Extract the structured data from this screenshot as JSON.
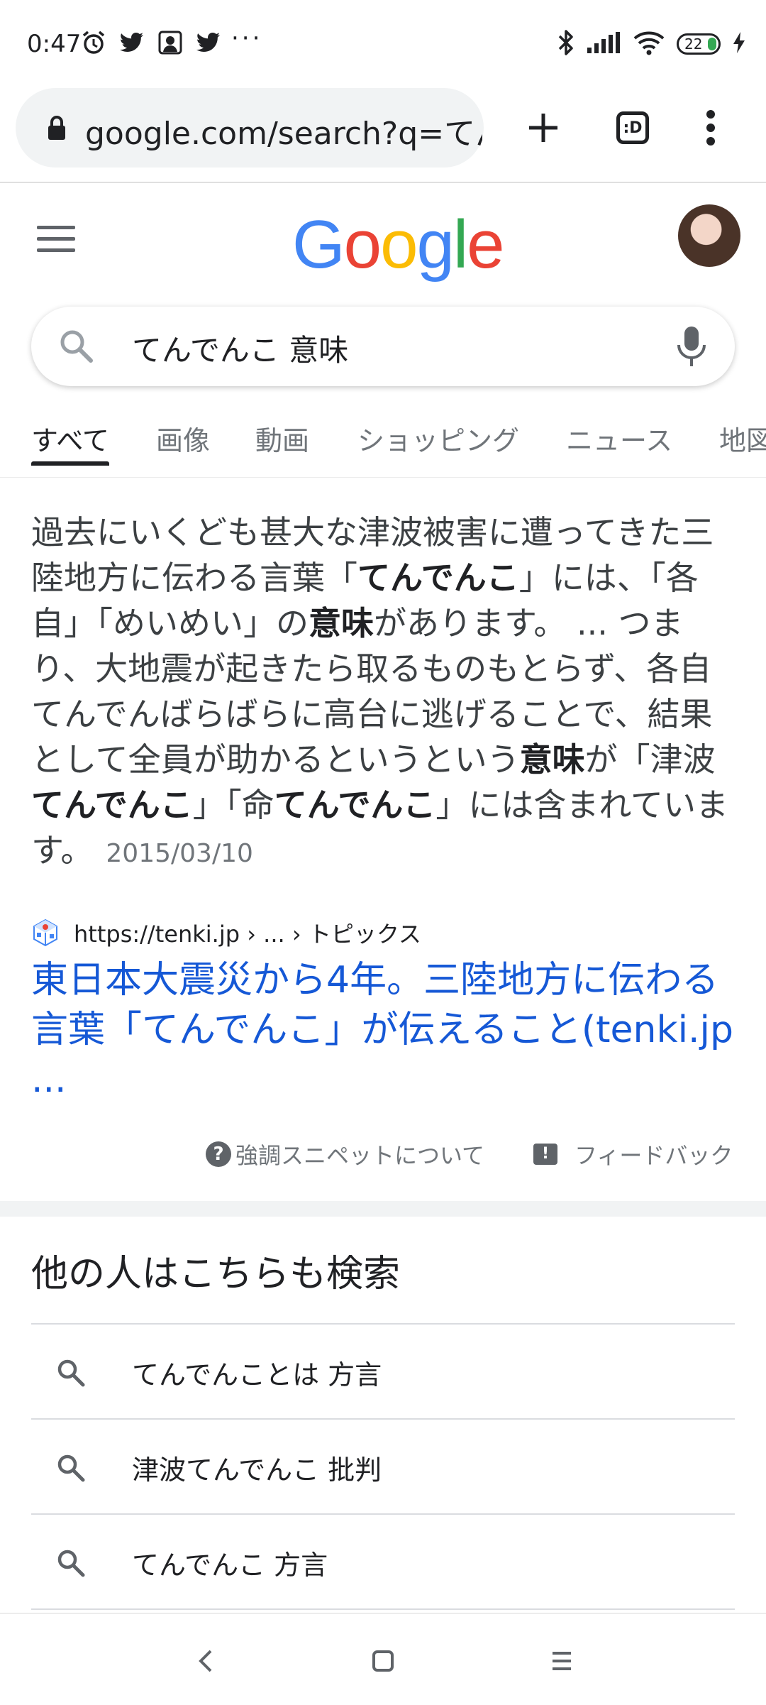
{
  "status_bar": {
    "time": "0:47",
    "overflow": "···",
    "battery_level": "22",
    "icons_left": [
      "alarm-icon",
      "twitter-icon",
      "app-icon",
      "twitter-icon"
    ],
    "icons_right": [
      "bluetooth-icon",
      "signal-icon",
      "wifi-icon",
      "battery-icon",
      "charging-icon"
    ]
  },
  "browser": {
    "url": "google.com/search?q=てんでんこ 意味",
    "tab_count": ":D"
  },
  "google": {
    "logo": [
      "G",
      "o",
      "o",
      "g",
      "l",
      "e"
    ],
    "logo_colors": [
      "#4285F4",
      "#EA4335",
      "#FBBC05",
      "#4285F4",
      "#34A853",
      "#EA4335"
    ],
    "query": "てんでんこ 意味"
  },
  "tabs": [
    "すべて",
    "画像",
    "動画",
    "ショッピング",
    "ニュース",
    "地図"
  ],
  "snippet": {
    "parts": [
      {
        "t": "過去にいくども甚大な津波被害に遭ってきた三陸地方に伝わる言葉「",
        "b": false
      },
      {
        "t": "てんでんこ",
        "b": true
      },
      {
        "t": "」には、「各自」「めいめい」の",
        "b": false
      },
      {
        "t": "意味",
        "b": true
      },
      {
        "t": "があります。 ... つまり、大地震が起きたら取るものもとらず、各自てんでんばらばらに高台に逃げることで、結果として全員が助かるというという",
        "b": false
      },
      {
        "t": "意味",
        "b": true
      },
      {
        "t": "が「津波",
        "b": false
      },
      {
        "t": "てんでんこ",
        "b": true
      },
      {
        "t": "」「命",
        "b": false
      },
      {
        "t": "てんでんこ",
        "b": true
      },
      {
        "t": "」には含まれています。",
        "b": false
      }
    ],
    "date": "2015/03/10",
    "source_url": "https://tenki.jp › ... › トピックス",
    "title": "東日本大震災から4年。三陸地方に伝わる言葉「てんでんこ」が伝えること(tenki.jp ...",
    "about_label": "強調スニペットについて",
    "feedback_label": "フィードバック"
  },
  "related": {
    "title": "他の人はこちらも検索",
    "items": [
      "てんでんことは 方言",
      "津波てんでんこ 批判",
      "てんでんこ 方言"
    ]
  },
  "colors": {
    "link": "#1558d6",
    "text": "#202124",
    "secondary": "#70757a"
  }
}
